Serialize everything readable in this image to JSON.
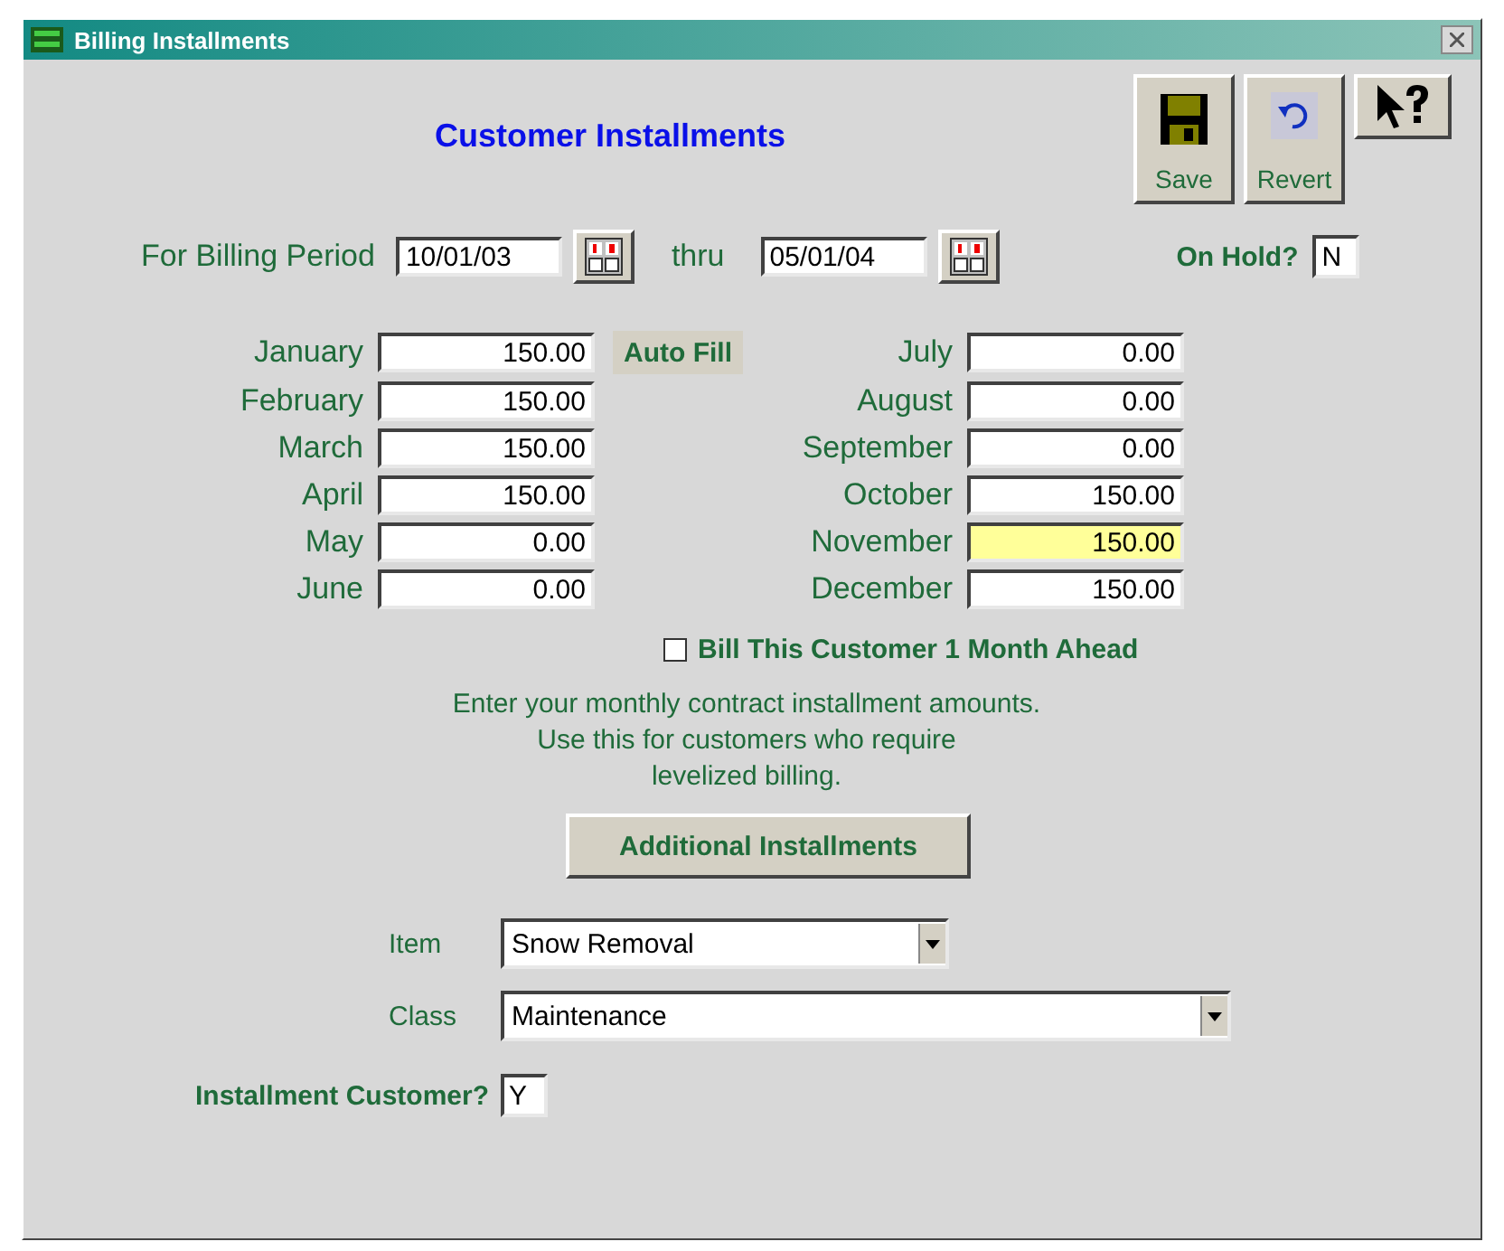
{
  "window": {
    "title": "Billing Installments"
  },
  "heading": "Customer Installments",
  "toolbar": [
    {
      "kind": "save",
      "label": "Save"
    },
    {
      "kind": "revert",
      "label": "Revert"
    },
    {
      "kind": "help"
    }
  ],
  "period": {
    "label": "For Billing Period",
    "from": "10/01/03",
    "thru_label": "thru",
    "to": "05/01/04"
  },
  "on_hold": {
    "label": "On Hold?",
    "value": "N"
  },
  "auto_fill": "Auto Fill",
  "months": [
    {
      "name": "January",
      "value": "150.00",
      "highlighted": false
    },
    {
      "name": "February",
      "value": "150.00",
      "highlighted": false
    },
    {
      "name": "March",
      "value": "150.00",
      "highlighted": false
    },
    {
      "name": "April",
      "value": "150.00",
      "highlighted": false
    },
    {
      "name": "May",
      "value": "0.00",
      "highlighted": false
    },
    {
      "name": "June",
      "value": "0.00",
      "highlighted": false
    },
    {
      "name": "July",
      "value": "0.00",
      "highlighted": false
    },
    {
      "name": "August",
      "value": "0.00",
      "highlighted": false
    },
    {
      "name": "September",
      "value": "0.00",
      "highlighted": false
    },
    {
      "name": "October",
      "value": "150.00",
      "highlighted": false
    },
    {
      "name": "November",
      "value": "150.00",
      "highlighted": true
    },
    {
      "name": "December",
      "value": "150.00",
      "highlighted": false
    }
  ],
  "bill_ahead": {
    "label": "Bill This Customer 1 Month Ahead",
    "checked": false
  },
  "note": [
    "Enter your monthly contract installment amounts.",
    "Use this for customers who require",
    "levelized billing."
  ],
  "additional_button": "Additional Installments",
  "item": {
    "label": "Item",
    "value": "Snow Removal"
  },
  "class": {
    "label": "Class",
    "value": "Maintenance"
  },
  "installment_customer": {
    "label": "Installment Customer?",
    "value": "Y"
  }
}
